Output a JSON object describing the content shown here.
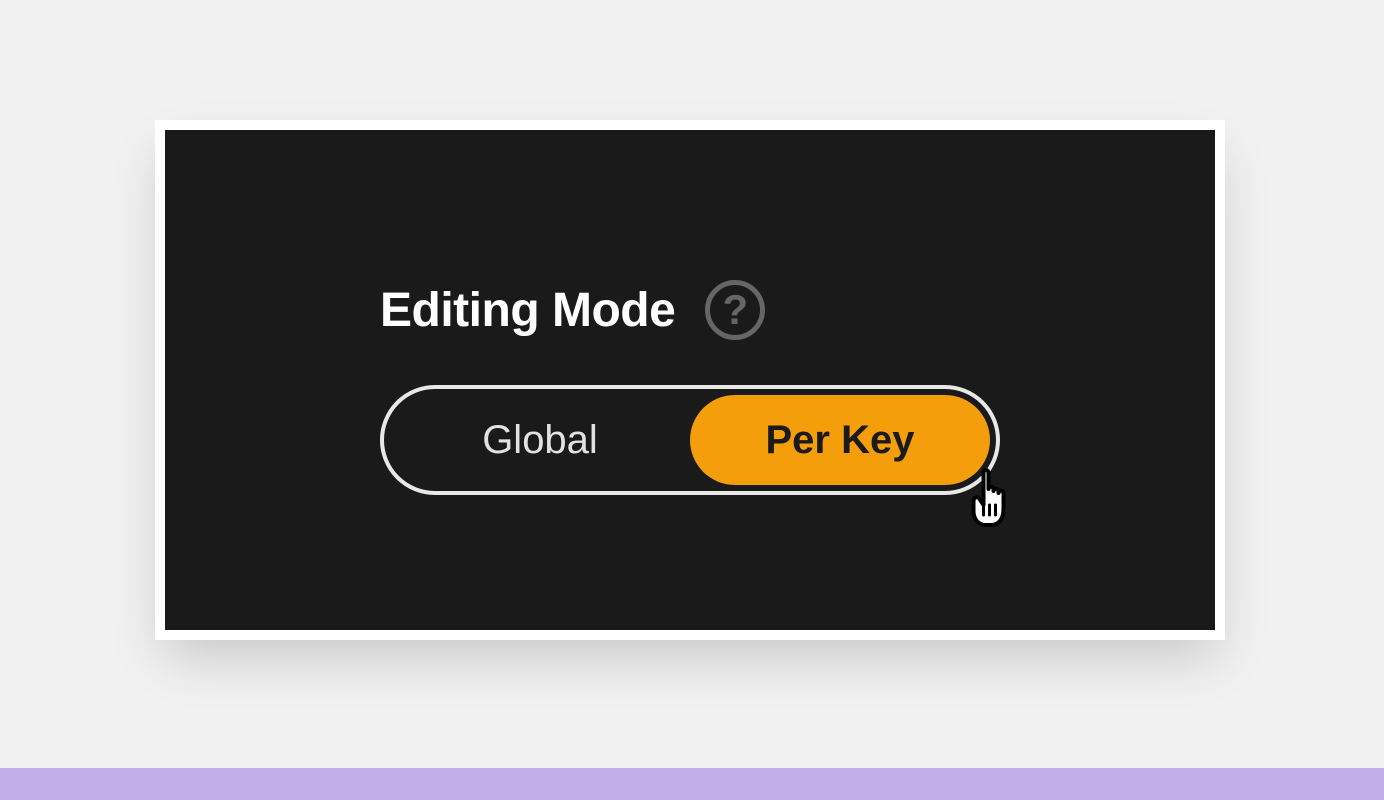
{
  "section": {
    "title": "Editing Mode",
    "help_icon": "?"
  },
  "toggle": {
    "options": [
      {
        "label": "Global",
        "active": false
      },
      {
        "label": "Per Key",
        "active": true
      }
    ]
  },
  "colors": {
    "accent": "#f59e0b",
    "panel_bg": "#1a1a1a",
    "footer": "#c2aee8"
  }
}
